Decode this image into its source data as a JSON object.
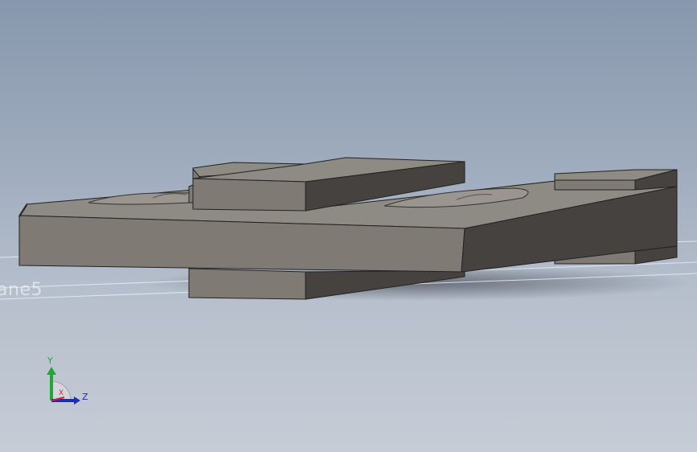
{
  "viewport": {
    "background_top": "#8797ad",
    "background_bottom": "#c6ccd6"
  },
  "reference_plane": {
    "label": "ane5"
  },
  "triad": {
    "y_label": "Y",
    "x_label": "X",
    "z_label": "Z",
    "y_color": "#1fa834",
    "x_color": "#cc2233",
    "z_color": "#1a2fb0"
  },
  "model": {
    "face_front": "#7f7a74",
    "face_top": "#8e8a84",
    "face_side": "#45423f",
    "edge_color": "#222222"
  }
}
